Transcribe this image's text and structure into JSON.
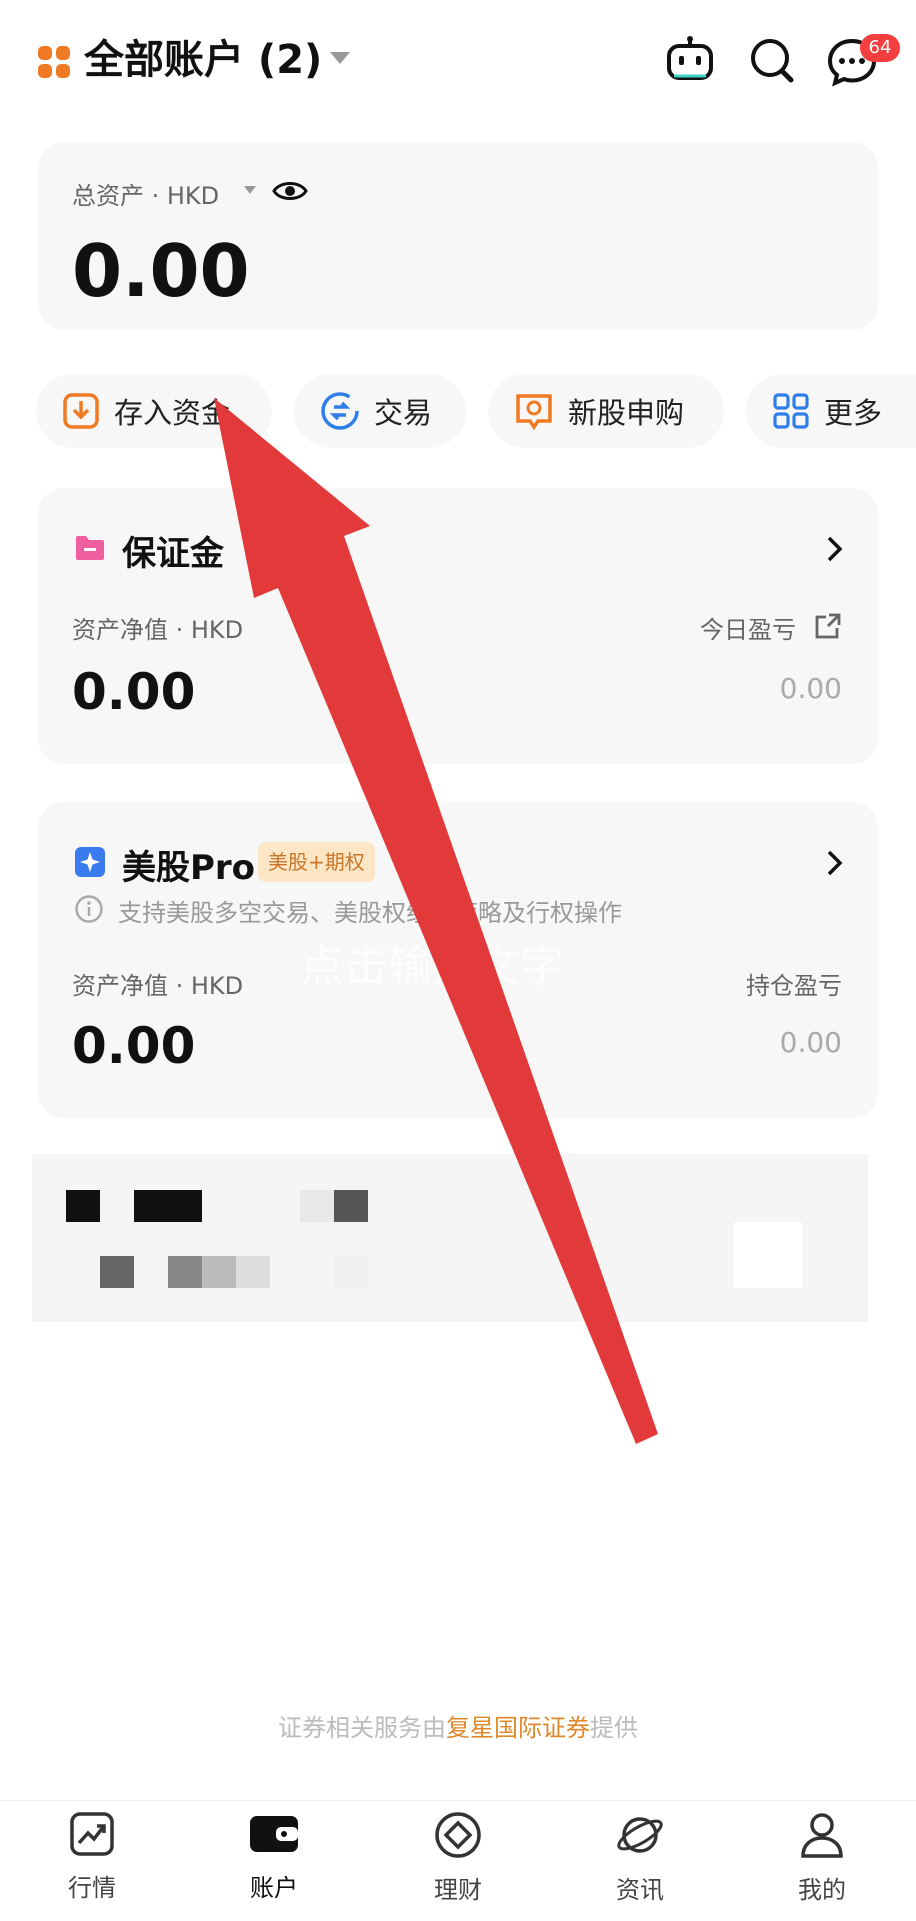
{
  "header": {
    "account_title": "全部账户 (2)",
    "notification_count": "64",
    "icons": [
      "grid-logo-icon",
      "robot-icon",
      "search-icon",
      "message-icon"
    ]
  },
  "total_assets": {
    "label": "总资产 · HKD",
    "value": "0.00"
  },
  "actions": [
    {
      "label": "存入资金",
      "icon": "deposit-icon"
    },
    {
      "label": "交易",
      "icon": "exchange-icon"
    },
    {
      "label": "新股申购",
      "icon": "ipo-icon"
    },
    {
      "label": "更多",
      "icon": "more-grid-icon"
    }
  ],
  "margin_account": {
    "title": "保证金",
    "net_label": "资产净值 · HKD",
    "net_value": "0.00",
    "pnl_label": "今日盈亏",
    "pnl_value": "0.00"
  },
  "us_pro_account": {
    "title": "美股Pro",
    "tag": "美股+期权",
    "description": "支持美股多空交易、美股",
    "description_tail": "权组合策略及行权操作",
    "net_label": "资产净值 · HKD",
    "net_value": "0.00",
    "pnl_label": "持仓盈亏",
    "pnl_value": "0.00"
  },
  "watermark": "点击输入文字",
  "footer": {
    "prefix": "证券相关服务由",
    "highlight": "复星国际证券",
    "suffix": "提供"
  },
  "tabs": [
    {
      "label": "行情",
      "icon": "chart-icon"
    },
    {
      "label": "账户",
      "icon": "wallet-icon"
    },
    {
      "label": "理财",
      "icon": "finance-icon"
    },
    {
      "label": "资讯",
      "icon": "planet-icon"
    },
    {
      "label": "我的",
      "icon": "profile-icon"
    }
  ],
  "colors": {
    "brand_orange": "#f07a24",
    "badge_red": "#f33f3f",
    "arrow_red": "#e23a3a",
    "link_orange": "#e0892b",
    "card_bg": "#f7f7f7"
  }
}
